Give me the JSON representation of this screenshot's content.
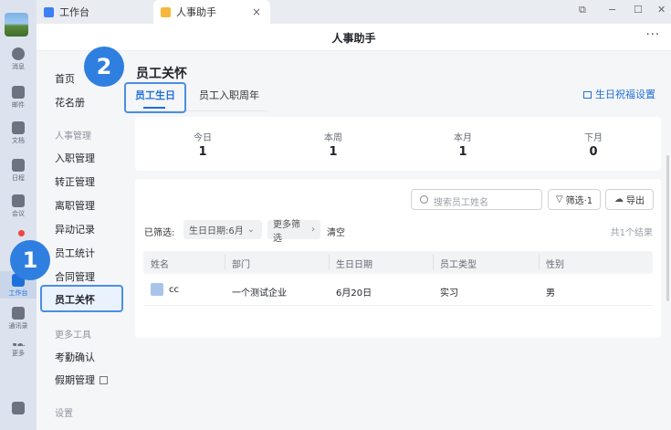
{
  "tabs": [
    {
      "label": "工作台"
    },
    {
      "label": "人事助手"
    }
  ],
  "titlebar": {
    "title": "人事助手",
    "more": "···"
  },
  "rail": {
    "items": [
      {
        "label": "消息"
      },
      {
        "label": "邮件"
      },
      {
        "label": "文档"
      },
      {
        "label": "日程"
      },
      {
        "label": "会议"
      },
      {
        "label": "工作台"
      },
      {
        "label": "通讯录"
      },
      {
        "label": "更多"
      }
    ]
  },
  "sidebar": {
    "home": "首页",
    "roster": "花名册",
    "group_hr": "人事管理",
    "onboarding": "入职管理",
    "regularization": "转正管理",
    "offboarding": "离职管理",
    "changes": "异动记录",
    "statistics": "员工统计",
    "contracts": "合同管理",
    "care": "员工关怀",
    "group_tools": "更多工具",
    "attendance": "考勤确认",
    "leave": "假期管理",
    "group_settings": "设置"
  },
  "page": {
    "title": "员工关怀",
    "tab_birthday": "员工生日",
    "tab_anniversary": "员工入职周年",
    "settings_link": "生日祝福设置"
  },
  "stats": [
    {
      "label": "今日",
      "value": "1"
    },
    {
      "label": "本周",
      "value": "1"
    },
    {
      "label": "本月",
      "value": "1"
    },
    {
      "label": "下月",
      "value": "0"
    }
  ],
  "toolbar": {
    "search_placeholder": "搜索员工姓名",
    "filter_button": "筛选·1",
    "export_button": "导出"
  },
  "filters": {
    "label": "已筛选:",
    "chip_birthday": "生日日期:6月",
    "chip_more": "更多筛选",
    "clear": "清空",
    "result": "共1个结果"
  },
  "table": {
    "columns": [
      "姓名",
      "部门",
      "生日日期",
      "员工类型",
      "性别"
    ],
    "rows": [
      {
        "name": "cc",
        "dept": "一个测试企业",
        "birthday": "6月20日",
        "type": "实习",
        "gender": "男"
      }
    ]
  },
  "annotations": [
    "1",
    "2"
  ],
  "colors": {
    "accent": "#1e6fd9",
    "annotation": "#2f7fe0",
    "badge": "#f0463f"
  }
}
